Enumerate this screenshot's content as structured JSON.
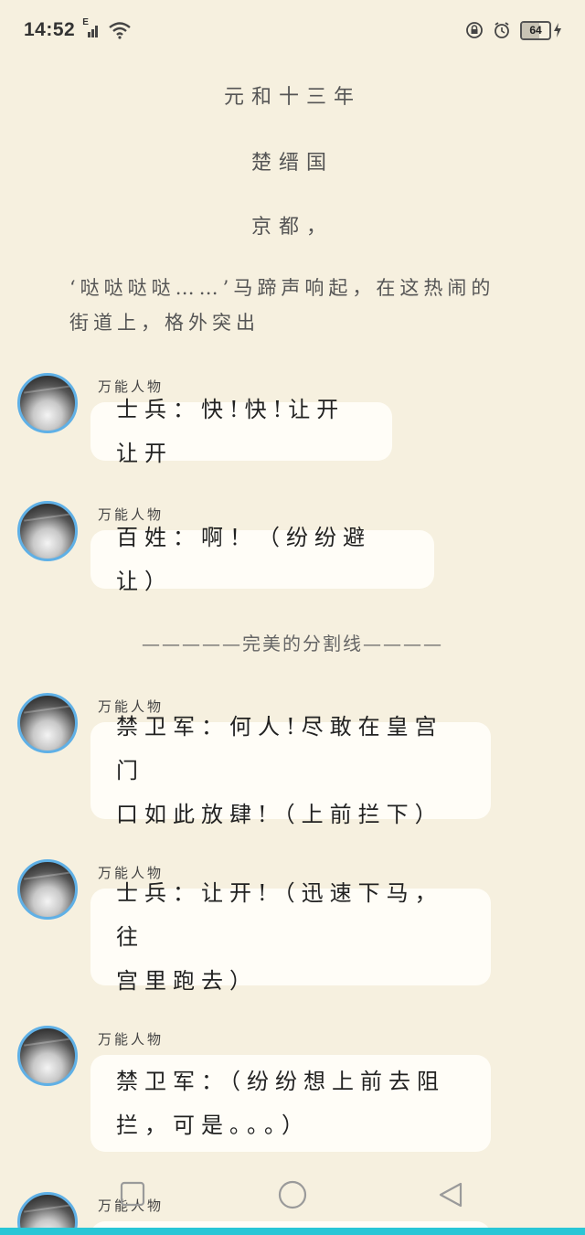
{
  "status_bar": {
    "time": "14:52",
    "network_label": "E",
    "battery": "64",
    "battery_level": 0.64
  },
  "narration": {
    "line1": "元和十三年",
    "line2": "楚缙国",
    "line3": "京都，",
    "paragraph": "‘哒哒哒哒……’马蹄声响起，在这热闹的街道上，格外突出"
  },
  "messages": [
    {
      "speaker": "万能人物",
      "text_lines": [
        "士兵：快!快!让开让开"
      ]
    },
    {
      "speaker": "万能人物",
      "text_lines": [
        "百姓：啊！（纷纷避让）"
      ]
    },
    {
      "speaker": "万能人物",
      "text_lines": [
        "禁卫军：何人!尽敢在皇宫门",
        "口如此放肆!（上前拦下）"
      ]
    },
    {
      "speaker": "万能人物",
      "text_lines": [
        "士兵：让开!（迅速下马，往",
        "宫里跑去）"
      ]
    },
    {
      "speaker": "万能人物",
      "text_lines": [
        "禁卫军：（纷纷想上前去阻",
        "拦，可是。。。）"
      ]
    },
    {
      "speaker": "万能人物",
      "text_lines": []
    }
  ],
  "divider": "—————完美的分割线————",
  "nav": {
    "icons": [
      "square-recents-icon",
      "circle-home-icon",
      "triangle-back-icon"
    ]
  },
  "colors": {
    "background": "#f6f0df",
    "bubble": "#fffdf7",
    "avatar_ring": "#5fb0e6",
    "bottom_strip": "#29c6d6"
  }
}
